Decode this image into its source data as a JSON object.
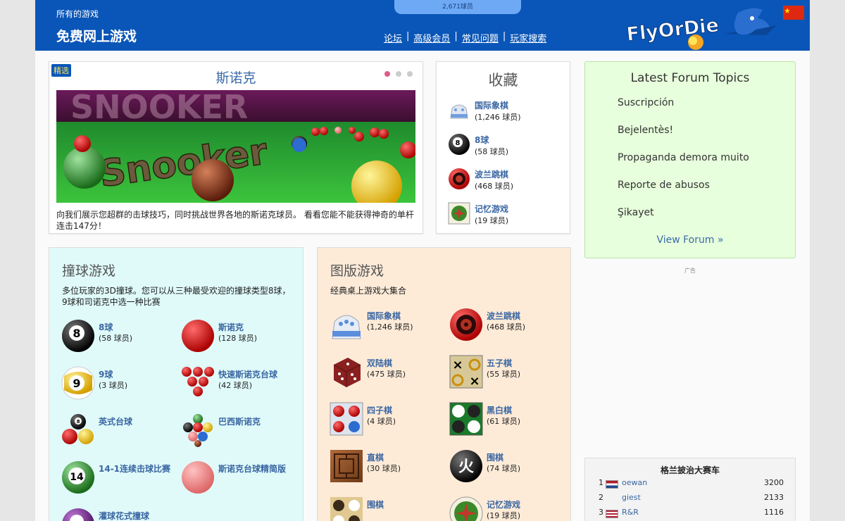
{
  "header": {
    "all_games": "所有的游戏",
    "title": "免费网上游戏",
    "players_online": "2,671球员",
    "nav": [
      "论坛",
      "高级会员",
      "常见问题",
      "玩家搜索"
    ],
    "logo_text": "FlyOrDie",
    "flag": "china-flag"
  },
  "featured": {
    "badge": "精选",
    "title": "斯诺克",
    "image_text": "Snooker",
    "description": "向我们展示您超群的击球技巧，同时挑战世界各地的斯诺克球员。 看看您能不能获得神奇的单杆连击147分！"
  },
  "favorites": {
    "title": "收藏",
    "items": [
      {
        "name": "国际象棋",
        "count": "(1,246 球员)",
        "icon": "chess-icon"
      },
      {
        "name": "8球",
        "count": "(58 球员)",
        "icon": "eight-ball-icon"
      },
      {
        "name": "波兰跳棋",
        "count": "(468 球员)",
        "icon": "checkers-icon"
      },
      {
        "name": "记忆游戏",
        "count": "(19 球员)",
        "icon": "memory-icon"
      }
    ]
  },
  "forum": {
    "title": "Latest Forum Topics",
    "topics": [
      "Suscripción",
      "Bejelentès!",
      "Propaganda demora muito",
      "Reporte de abusos",
      "Şikayet"
    ],
    "view": "View Forum »"
  },
  "ad_label": "广告",
  "billiards": {
    "title": "撞球游戏",
    "description": "多位玩家的3D撞球。您可以从三种最受欢迎的撞球类型8球，9球和司诺克中选一种比赛",
    "games": [
      {
        "name": "8球",
        "count": "(58 球员)",
        "icon": "eight-ball-icon"
      },
      {
        "name": "斯诺克",
        "count": "(128 球员)",
        "icon": "snooker-ball-icon"
      },
      {
        "name": "9球",
        "count": "(3 球员)",
        "icon": "nine-ball-icon"
      },
      {
        "name": "快速斯诺克台球",
        "count": "(42 球员)",
        "icon": "speed-snooker-icon"
      },
      {
        "name": "英式台球",
        "count": "",
        "icon": "uk-pool-icon"
      },
      {
        "name": "巴西斯诺克",
        "count": "",
        "icon": "brazil-snooker-icon"
      },
      {
        "name": "14-1连续击球比赛",
        "count": "",
        "icon": "fourteen-one-icon"
      },
      {
        "name": "斯诺克台球精简版",
        "count": "",
        "icon": "snooker-lite-icon"
      },
      {
        "name": "灌球花式撞球",
        "count": "",
        "icon": "trick-shot-icon"
      }
    ]
  },
  "board": {
    "title": "图版游戏",
    "description": "经典桌上游戏大集合",
    "games": [
      {
        "name": "国际象棋",
        "count": "(1,246 球员)",
        "icon": "chess-icon"
      },
      {
        "name": "波兰跳棋",
        "count": "(468 球员)",
        "icon": "checkers-icon"
      },
      {
        "name": "双陆棋",
        "count": "(475 球员)",
        "icon": "dice-icon"
      },
      {
        "name": "五子棋",
        "count": "(55 球员)",
        "icon": "gomoku-icon"
      },
      {
        "name": "四子棋",
        "count": "(4 球员)",
        "icon": "connect-four-icon"
      },
      {
        "name": "黑白棋",
        "count": "(61 球员)",
        "icon": "reversi-icon"
      },
      {
        "name": "直棋",
        "count": "(30 球员)",
        "icon": "mill-icon"
      },
      {
        "name": "围棋",
        "count": "(74 球员)",
        "icon": "go-icon"
      },
      {
        "name": "围棋",
        "count": "",
        "icon": "go-stones-icon"
      },
      {
        "name": "记忆游戏",
        "count": "(19 球员)",
        "icon": "memory-icon"
      }
    ]
  },
  "race": {
    "title": "格兰披治大赛车",
    "rows": [
      {
        "rank": "1",
        "name": "oewan",
        "score": "3200",
        "flag": "netherlands-flag"
      },
      {
        "rank": "2",
        "name": "giest",
        "score": "2133",
        "flag": ""
      },
      {
        "rank": "3",
        "name": "R&R",
        "score": "1116",
        "flag": "usa-flag"
      }
    ]
  },
  "colors": {
    "header_blue": "#0a56b8",
    "link_blue": "#3a66a2",
    "forum_bg": "#e7ffdc",
    "billiards_bg": "#dffaf9",
    "board_bg": "#fdebd8"
  }
}
